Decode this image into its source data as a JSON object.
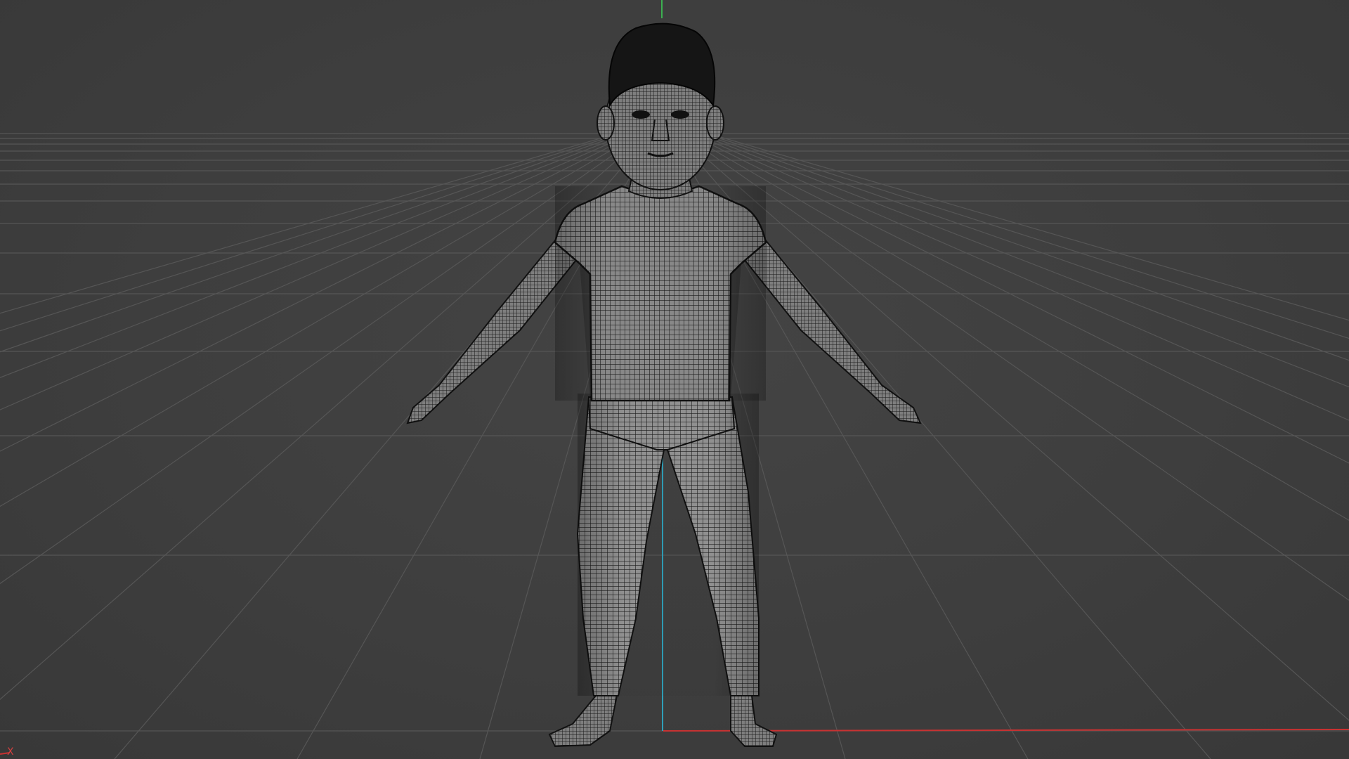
{
  "viewport": {
    "view": "front",
    "display_mode": "wireframe-on-shaded",
    "background_color": "#3e3e3e",
    "grid_color": "#555555",
    "x_axis_color": "#c83232",
    "z_axis_color": "#2f9fb8",
    "y_axis_top_color": "#3cb050"
  },
  "axes": {
    "x_label": "X"
  },
  "model": {
    "subject": "child-character-a-pose",
    "icon": "wireframe-mesh",
    "mesh_line_color": "#151515",
    "surface_color": "#8a8a8a"
  }
}
